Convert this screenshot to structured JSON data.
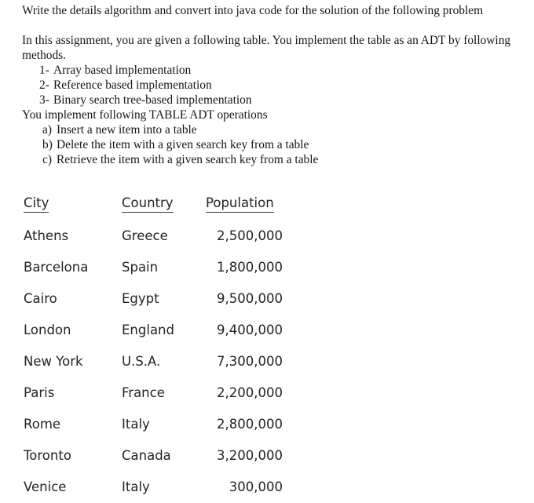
{
  "document": {
    "intro": "Write the details algorithm and convert into java code for the solution of the following problem",
    "assignment_paragraph": "In this assignment, you are given a following table. You implement the table as an ADT by following methods.",
    "implementation_methods": [
      {
        "marker": "1-",
        "text": "Array based implementation"
      },
      {
        "marker": "2-",
        "text": "Reference based implementation"
      },
      {
        "marker": "3-",
        "text": "Binary search tree-based implementation"
      }
    ],
    "operations_heading": "You implement following TABLE ADT operations",
    "operations": [
      {
        "marker": "a)",
        "text": "Insert a new item into a table"
      },
      {
        "marker": "b)",
        "text": "Delete the item with a given search key from a table"
      },
      {
        "marker": "c)",
        "text": "Retrieve the item with a given search key from a table"
      }
    ]
  },
  "table": {
    "columns": [
      "City",
      "Country",
      "Population"
    ],
    "rows": [
      {
        "city": "Athens",
        "country": "Greece",
        "population": "2,500,000"
      },
      {
        "city": "Barcelona",
        "country": "Spain",
        "population": "1,800,000"
      },
      {
        "city": "Cairo",
        "country": "Egypt",
        "population": "9,500,000"
      },
      {
        "city": "London",
        "country": "England",
        "population": "9,400,000"
      },
      {
        "city": "New York",
        "country": "U.S.A.",
        "population": "7,300,000"
      },
      {
        "city": "Paris",
        "country": "France",
        "population": "2,200,000"
      },
      {
        "city": "Rome",
        "country": "Italy",
        "population": "2,800,000"
      },
      {
        "city": "Toronto",
        "country": "Canada",
        "population": "3,200,000"
      },
      {
        "city": "Venice",
        "country": "Italy",
        "population": "300,000"
      }
    ]
  },
  "colors": {
    "page_background": "#ffffff",
    "body_text": "#15161a",
    "table_text": "#232323",
    "header_rule": "#3a3a3a"
  }
}
